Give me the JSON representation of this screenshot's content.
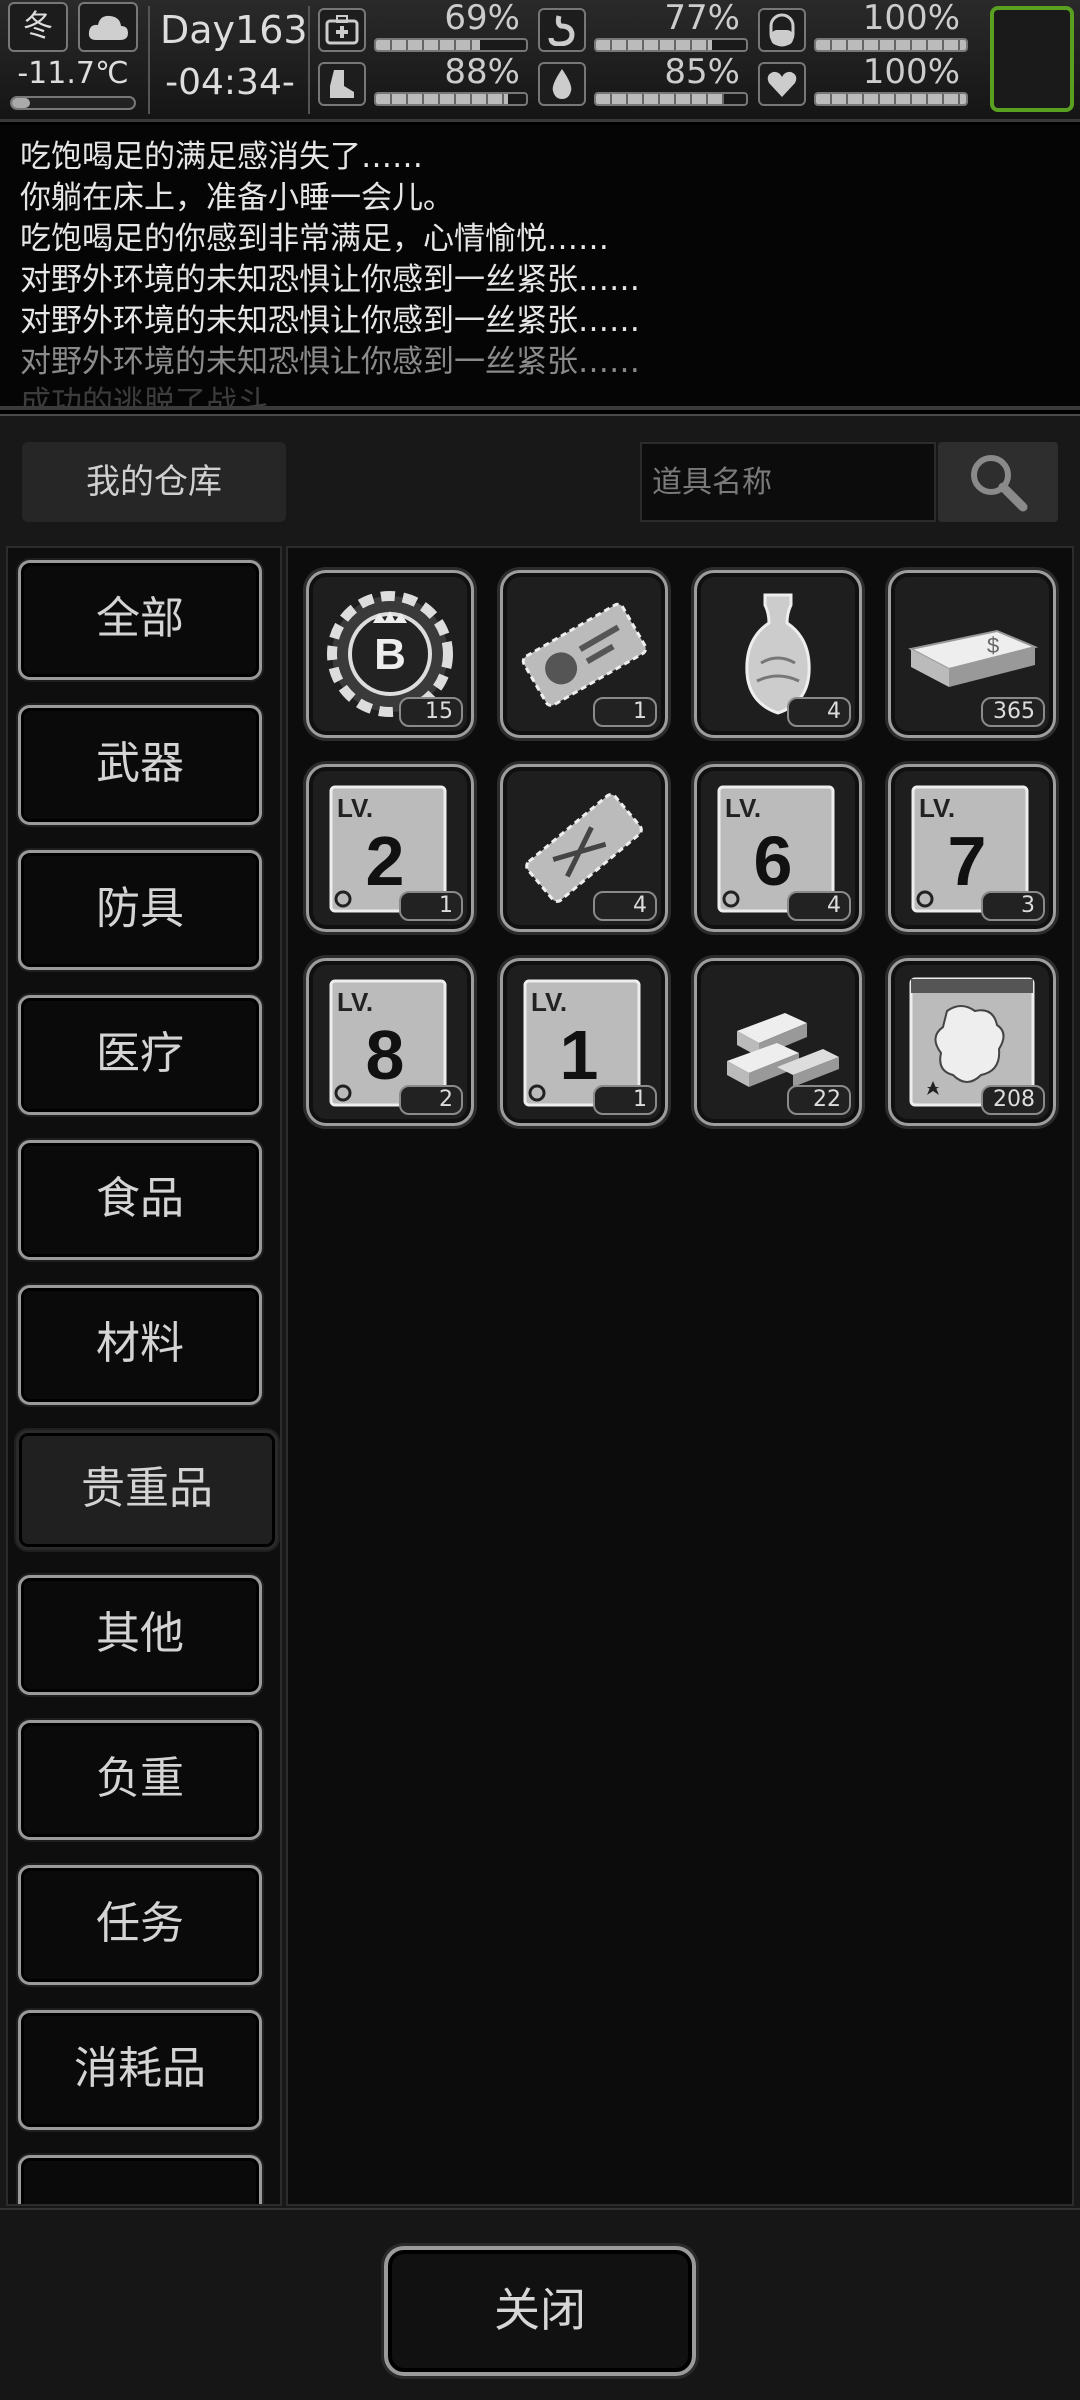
{
  "status": {
    "season": "冬",
    "weather_icon": "cloud-icon",
    "temperature": "-11.7℃",
    "day": "Day163",
    "time": "-04:34-",
    "stats": [
      {
        "name": "health",
        "icon": "medkit-icon",
        "value": "69%",
        "level": 0.69
      },
      {
        "name": "hunger",
        "icon": "stomach-icon",
        "value": "77%",
        "level": 0.77
      },
      {
        "name": "sanity",
        "icon": "pill-icon",
        "value": "100%",
        "level": 1.0
      },
      {
        "name": "stamina",
        "icon": "boot-icon",
        "value": "88%",
        "level": 0.88
      },
      {
        "name": "thirst",
        "icon": "water-drop-icon",
        "value": "85%",
        "level": 0.85
      },
      {
        "name": "mood",
        "icon": "heart-icon",
        "value": "100%",
        "level": 1.0
      }
    ]
  },
  "log": [
    "吃饱喝足的满足感消失了……",
    "你躺在床上，准备小睡一会儿。",
    "吃饱喝足的你感到非常满足，心情愉悦……",
    "对野外环境的未知恐惧让你感到一丝紧张……",
    "对野外环境的未知恐惧让你感到一丝紧张……",
    "对野外环境的未知恐惧让你感到一丝紧张……",
    "成功的逃脱了战斗"
  ],
  "warehouse": {
    "tab_label": "我的仓库",
    "search_placeholder": "道具名称",
    "categories": [
      "全部",
      "武器",
      "防具",
      "医疗",
      "食品",
      "材料",
      "贵重品",
      "其他",
      "负重",
      "任务",
      "消耗品",
      ""
    ],
    "active_category": "贵重品",
    "items": [
      {
        "icon": "bitcoin-chip-icon",
        "count": "15"
      },
      {
        "icon": "id-ticket-icon",
        "count": "1"
      },
      {
        "icon": "vase-icon",
        "count": "4"
      },
      {
        "icon": "cash-stack-icon",
        "count": "365"
      },
      {
        "icon": "lv2-card-icon",
        "count": "1",
        "label": "2"
      },
      {
        "icon": "scissors-ticket-icon",
        "count": "4"
      },
      {
        "icon": "lv6-card-icon",
        "count": "4",
        "label": "6"
      },
      {
        "icon": "lv7-card-icon",
        "count": "3",
        "label": "7"
      },
      {
        "icon": "lv8-card-icon",
        "count": "2",
        "label": "8"
      },
      {
        "icon": "lv1-card-icon",
        "count": "1",
        "label": "1"
      },
      {
        "icon": "gold-bars-icon",
        "count": "22"
      },
      {
        "icon": "monster-card-icon",
        "count": "208"
      }
    ],
    "lv_prefix": "LV.",
    "close_label": "关闭"
  }
}
